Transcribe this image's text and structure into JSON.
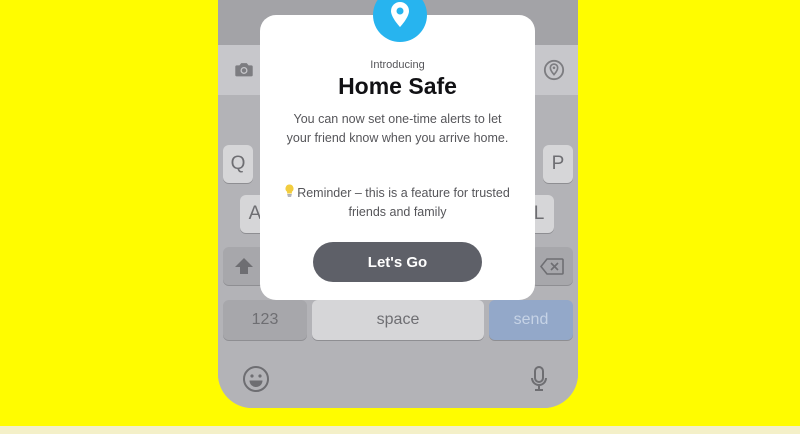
{
  "modal": {
    "intro_label": "Introducing",
    "title": "Home Safe",
    "description": "You can now set one-time alerts to let your friend know when you arrive home.",
    "reminder_icon": "lightbulb-icon",
    "reminder_text": "Reminder – this is a feature for trusted friends and family",
    "cta_label": "Let's Go",
    "badge_icon": "location-pin-icon"
  },
  "chat_bar": {
    "left_icon": "camera-icon",
    "right_icon": "location-pin-icon"
  },
  "keyboard": {
    "row1_left": "Q",
    "row1_right": "P",
    "row2_left": "A",
    "row2_right": "L",
    "numbers_label": "123",
    "space_label": "space",
    "send_label": "send",
    "shift_icon": "shift-arrow-icon",
    "delete_icon": "backspace-icon",
    "emoji_icon": "emoji-icon",
    "mic_icon": "microphone-icon"
  },
  "colors": {
    "background": "#FFFC00",
    "accent_blue": "#27B4EF",
    "cta_button": "#5E6068",
    "send_key": "#93A8C9"
  }
}
